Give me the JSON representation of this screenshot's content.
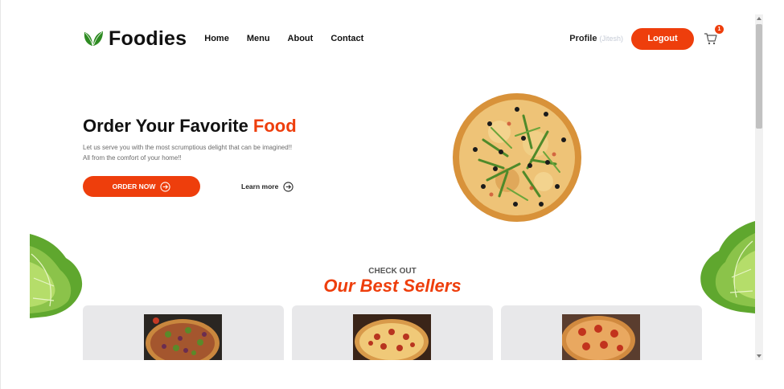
{
  "nav": {
    "brand": "Foodies",
    "links": [
      "Home",
      "Menu",
      "About",
      "Contact"
    ],
    "profile_label": "Profile",
    "profile_user": "(Jitesh)",
    "logout_label": "Logout",
    "cart_count": "1"
  },
  "hero": {
    "title_main": "Order Your Favorite ",
    "title_accent": "Food",
    "subtitle_line1": "Let us serve you with the most scrumptious delight that can be imagined!!",
    "subtitle_line2": "All from the comfort of your home!!",
    "order_label": "ORDER NOW",
    "learn_label": "Learn more"
  },
  "best_sellers": {
    "kicker": "CHECK OUT",
    "title": "Our Best Sellers"
  },
  "colors": {
    "accent": "#ee3e0c",
    "card_bg": "#e8e8ea",
    "leaf_green": "#2e8b22"
  },
  "icons": [
    "leaf-icon",
    "cart-icon",
    "arrow-circle-icon"
  ]
}
